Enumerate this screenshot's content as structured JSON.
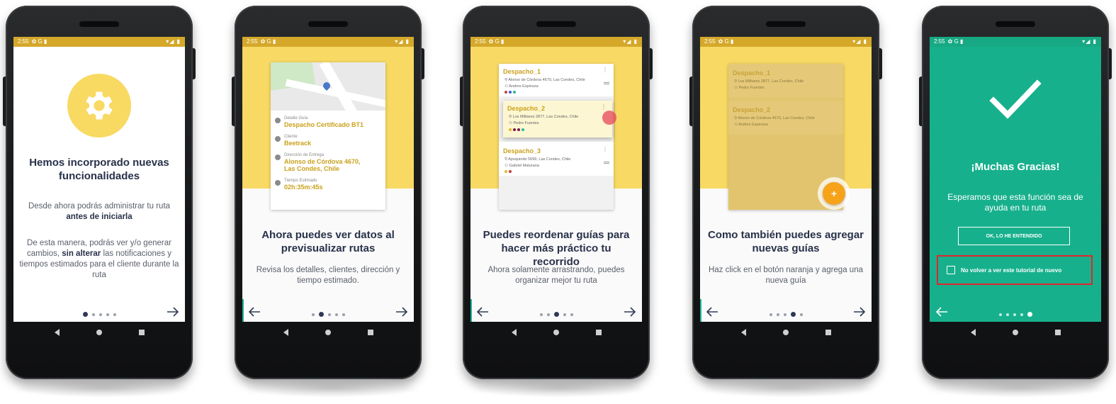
{
  "status_time": "2:55",
  "status_icons_left": "✿ G ▮",
  "status_icons_right": "▾◢ ▮",
  "colors": {
    "accent_yellow": "#f7d964",
    "gold_text": "#caa11c",
    "navy": "#283149",
    "success_green": "#17b08d",
    "highlight_red": "#e1252d",
    "fab_orange": "#f6a31a"
  },
  "screens": [
    {
      "title": "Hemos incorporado nuevas funcionalidades",
      "desc_1_pre": "Desde ahora podrás administrar tu ruta",
      "desc_1_bold": "antes de iniciarla",
      "desc_2_pre": "De esta manera, podrás ver y/o generar cambios,",
      "desc_2_bold": "sin alterar",
      "desc_2_post": "las notificaciones y tiempos estimados para el cliente durante la ruta",
      "icon": "gear-icon"
    },
    {
      "title": "Ahora puedes ver datos al previsualizar rutas",
      "desc": "Revisa los detalles, clientes, dirección y tiempo estimado.",
      "card": {
        "detail_label": "Detalle Guía",
        "detail_value": "Despacho Certificado BT1",
        "client_label": "Cliente",
        "client_value": "Beetrack",
        "address_label": "Dirección de Entrega",
        "address_value_1": "Alonso de Córdova 4670,",
        "address_value_2": "Las Condes, Chile",
        "time_label": "Tiempo Estimado",
        "time_value": "02h:35m:45s"
      }
    },
    {
      "title": "Puedes reordenar guías para hacer más práctico tu recorrido",
      "desc": "Ahora solamente arrastrando, puedes organizar mejor tu ruta",
      "items": [
        {
          "title": "Despacho_1",
          "address": "Alonso de Córdova 4670, Las Condes, Chile",
          "person": "Andres Espinoza"
        },
        {
          "title": "Despacho_2",
          "address": "Los Militares 2877, Las Condes, Chile",
          "person": "Pedro Fuentes"
        },
        {
          "title": "Despacho_3",
          "address": "Apoquindo 5699, Las Condes, Chile",
          "person": "Gabriel Maturana"
        }
      ]
    },
    {
      "title": "Como también puedes agregar nuevas guías",
      "desc": "Haz click en el botón naranja y agrega una nueva guía",
      "items": [
        {
          "title": "Despacho_1",
          "address": "Los Militares 2877, Las Condes, Chile",
          "person": "Pedro Fuentes"
        },
        {
          "title": "Despacho_2",
          "address": "Alonso de Córdova 4670, Las Condes, Chile",
          "person": "Andres Espinoza"
        }
      ],
      "fab_label": "+"
    },
    {
      "title": "¡Muchas Gracias!",
      "desc": "Esperamos que esta función sea de ayuda en tu ruta",
      "button": "OK, LO HE ENTENDIDO",
      "checkbox_label": "No volver a ver este tutorial de nuevo"
    }
  ]
}
